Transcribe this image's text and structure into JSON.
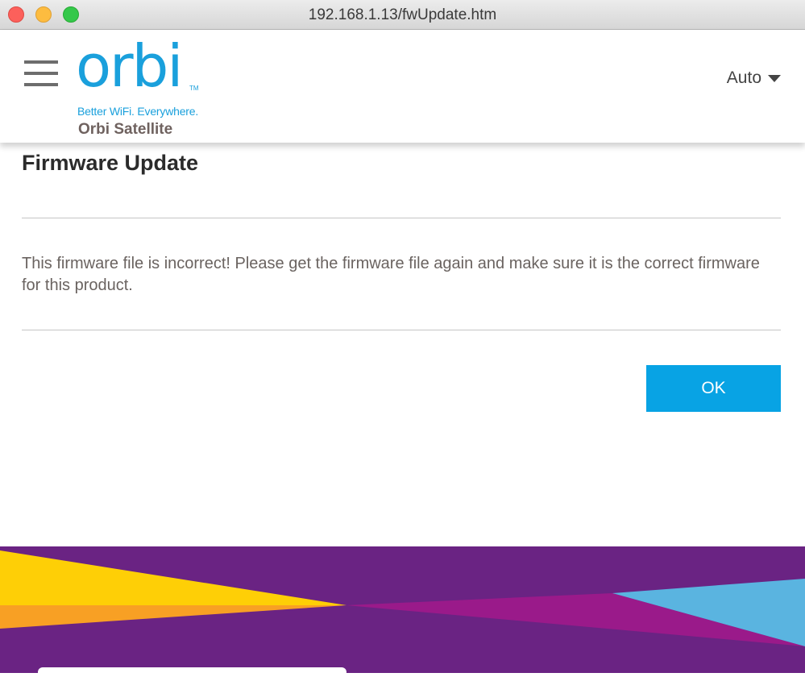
{
  "window": {
    "title": "192.168.1.13/fwUpdate.htm"
  },
  "header": {
    "logo_text": "orbi",
    "trademark": "TM",
    "tagline": "Better WiFi. Everywhere.",
    "product_name": "Orbi Satellite",
    "language": "Auto"
  },
  "main": {
    "title": "Firmware Update",
    "message": "This firmware file is incorrect! Please get the firmware file again and make sure it is the correct firmware for this product.",
    "ok_label": "OK"
  },
  "colors": {
    "brand_blue": "#1aa0dc",
    "button_blue": "#08a3e4",
    "footer_purple": "#6a2383",
    "footer_yellow": "#fecf06",
    "footer_orange": "#f8a024",
    "footer_magenta": "#9a1a8a",
    "footer_lightblue": "#5ab4e0"
  },
  "icons": {
    "menu": "hamburger-menu-icon",
    "dropdown": "caret-down-icon"
  }
}
